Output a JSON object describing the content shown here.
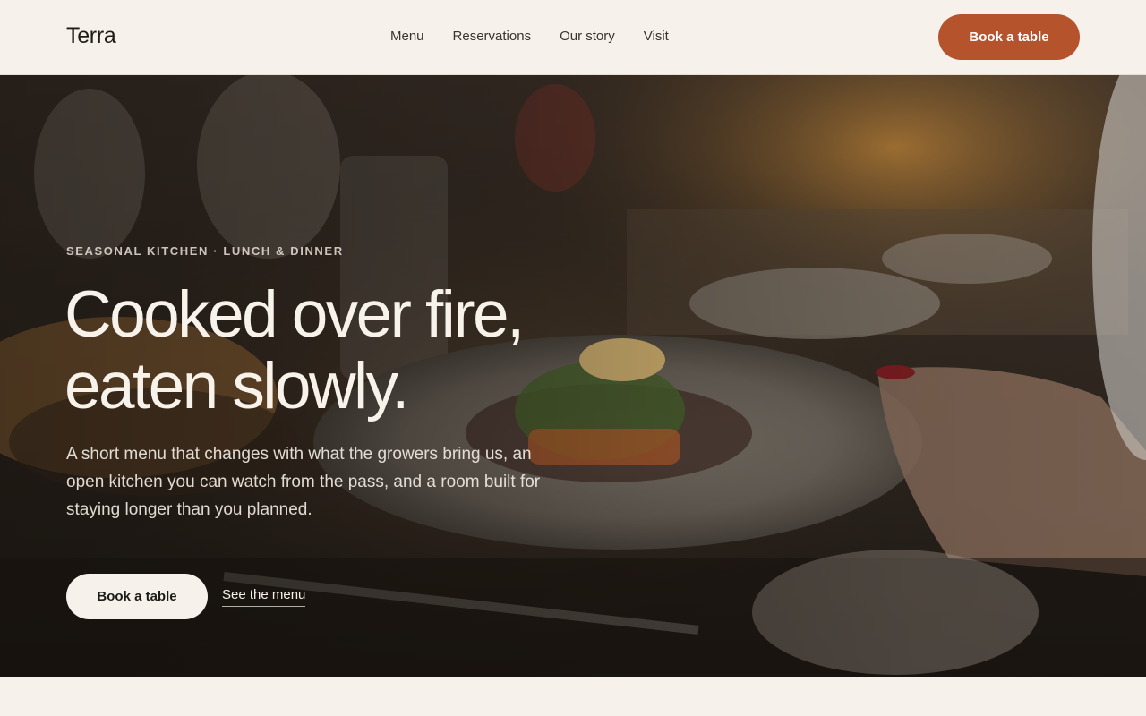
{
  "header": {
    "brand": "Terra",
    "nav": [
      "Menu",
      "Reservations",
      "Our story",
      "Visit"
    ],
    "cta_label": "Book a table"
  },
  "hero": {
    "eyebrow": "SEASONAL KITCHEN · LUNCH & DINNER",
    "headline_line1": "Cooked over fire,",
    "headline_line2": "eaten slowly.",
    "lede": "A short menu that changes with what the growers bring us, an open kitchen you can watch from the pass, and a room built for staying longer than you planned.",
    "primary_cta": "Book a table",
    "secondary_link": "See the menu"
  },
  "colors": {
    "accent": "#b5532d",
    "background": "#f6f2eb",
    "text": "#1e1a16"
  }
}
